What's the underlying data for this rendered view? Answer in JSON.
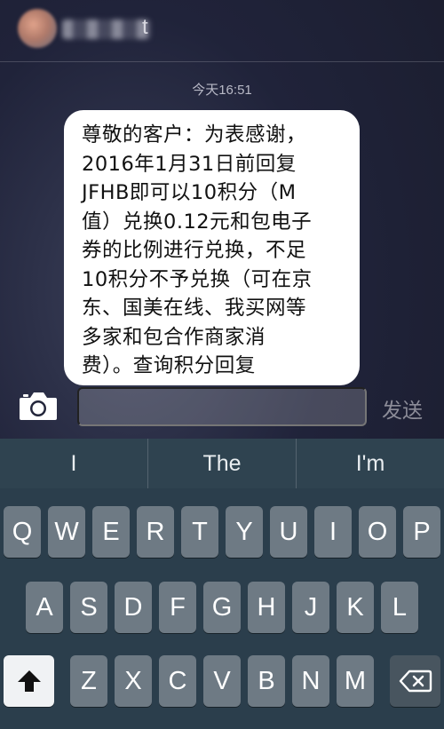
{
  "header": {
    "contact_name": "t"
  },
  "conversation": {
    "timestamp": "今天16:51",
    "messages": [
      {
        "text": "尊敬的客户：为表感谢，\n2016年1月31日前回复\nJFHB即可以10积分（M\n值）兑换0.12元和包电子\n券的比例进行兑换，不足\n10积分不予兑换（可在京\n东、国美在线、我买网等\n多家和包合作商家消\n费）。查询积分回复"
      }
    ]
  },
  "composer": {
    "input_value": "",
    "send_label": "发送"
  },
  "keyboard": {
    "suggestions": [
      "I",
      "The",
      "I'm"
    ],
    "row1": [
      "Q",
      "W",
      "E",
      "R",
      "T",
      "Y",
      "U",
      "I",
      "O",
      "P"
    ],
    "row2": [
      "A",
      "S",
      "D",
      "F",
      "G",
      "H",
      "J",
      "K",
      "L"
    ],
    "row3": [
      "Z",
      "X",
      "C",
      "V",
      "B",
      "N",
      "M"
    ]
  },
  "colors": {
    "bubble": "#ffffff",
    "keyboard_bg": "#2b3e4c",
    "key": "#6e7a84",
    "special_key": "#48555f"
  }
}
